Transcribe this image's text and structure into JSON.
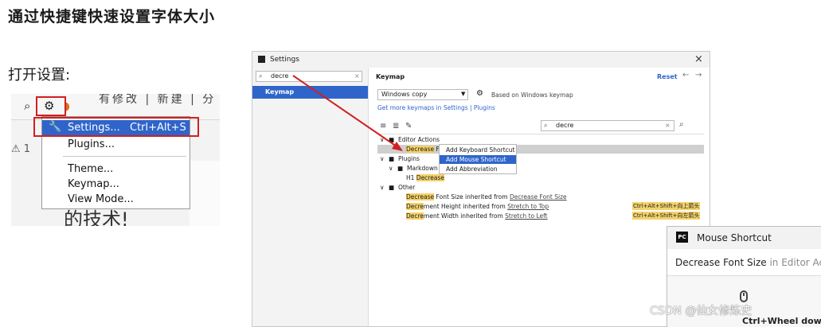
{
  "page": {
    "title": "通过快捷键快速设置字体大小",
    "subtitle": "打开设置:"
  },
  "menu_shot": {
    "toolbar_garbled": "有修改 | 新建 | 分",
    "warning": "⚠ 1",
    "bg_text": "的技术!",
    "items": {
      "settings_label": "Settings...",
      "settings_shortcut": "Ctrl+Alt+S",
      "plugins": "Plugins...",
      "theme": "Theme...",
      "keymap": "Keymap...",
      "view_mode": "View Mode..."
    }
  },
  "settings_window": {
    "title": "Settings",
    "close": "×",
    "search_value": "decre",
    "nav_keymap": "Keymap",
    "header": "Keymap",
    "reset": "Reset",
    "keymap_select": "Windows copy",
    "based_on": "Based on Windows keymap",
    "get_more": "Get more keymaps in Settings | Plugins",
    "tree_search_value": "decre",
    "tree": {
      "editor_actions": "Editor Actions",
      "decrease_hl": "Decrease",
      "decrease_rest": " Fo",
      "plugins": "Plugins",
      "markdown": "Markdown",
      "md_prefix": "H1 ",
      "md_hl": "Decrease",
      "other": "Other",
      "r1_hl": "Decrease",
      "r1_rest": " Font Size",
      "r1_inh": " inherited from ",
      "r1_link": "Decrease Font Size",
      "r2_hl": "Decre",
      "r2_rest": "ment Height",
      "r2_inh": " inherited from ",
      "r2_link": "Stretch to Top",
      "r2_sc": "Ctrl+Alt+Shift+向上箭头",
      "r3_hl": "Decre",
      "r3_rest": "ment Width",
      "r3_inh": " inherited from ",
      "r3_link": "Stretch to Left",
      "r3_sc": "Ctrl+Alt+Shift+向左箭头"
    },
    "context_menu": {
      "item1": "Add Keyboard Shortcut",
      "item2": "Add Mouse Shortcut",
      "item3": "Add Abbreviation"
    }
  },
  "mouse_shortcut": {
    "title": "Mouse Shortcut",
    "action": "Decrease Font Size",
    "action_context": " in Editor Actio",
    "combo": "Ctrl+Wheel down"
  },
  "watermark": "CSDN @仙女修炼史"
}
